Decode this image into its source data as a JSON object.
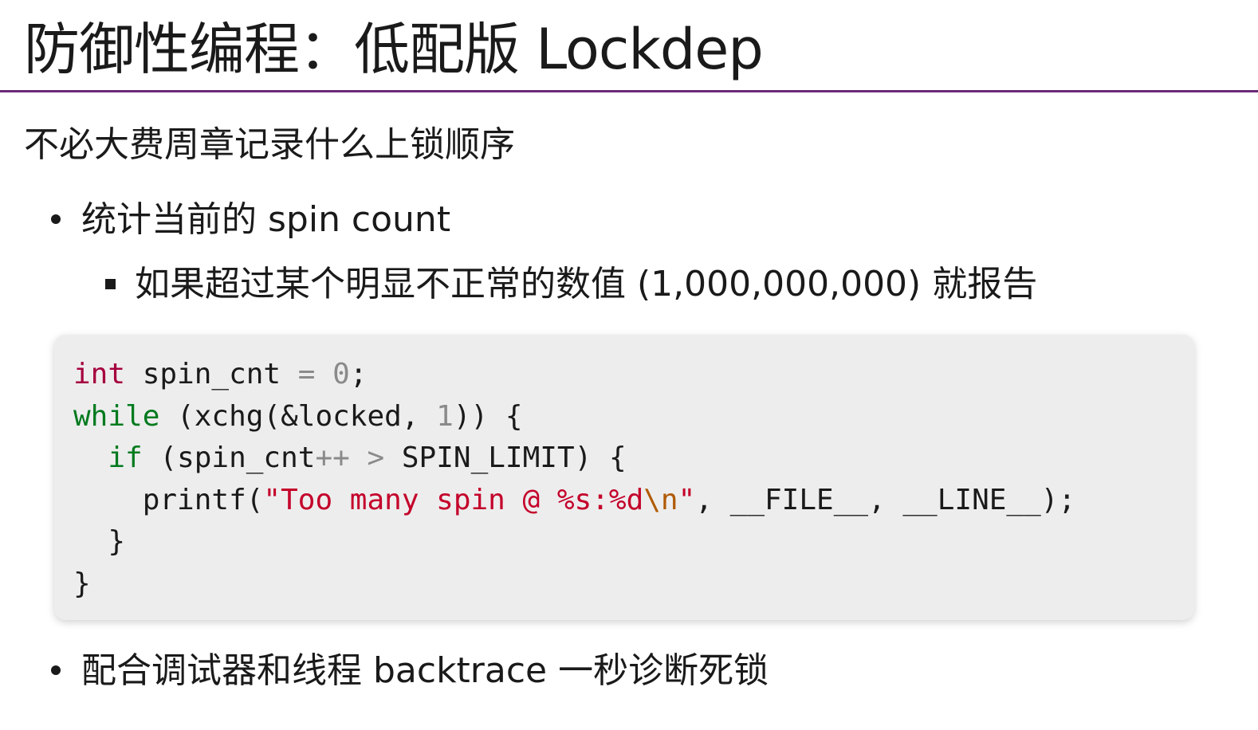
{
  "slide": {
    "title": "防御性编程：低配版 Lockdep",
    "intro": "不必大费周章记录什么上锁顺序",
    "bullets": [
      "统计当前的 spin count",
      "配合调试器和线程 backtrace 一秒诊断死锁"
    ],
    "sub_bullet": "如果超过某个明显不正常的数值 (1,000,000,000) 就报告",
    "code": {
      "line1": {
        "kw": "int",
        "ident": " spin_cnt ",
        "op": "=",
        "sp": " ",
        "num": "0",
        "end": ";"
      },
      "line2": {
        "kw": "while",
        "a": " (xchg(&locked, ",
        "num": "1",
        "b": ")) {"
      },
      "line3": {
        "indent": "  ",
        "kw": "if",
        "a": " (spin_cnt",
        "op1": "++",
        "sp": " ",
        "op2": ">",
        "b": " SPIN_LIMIT) {"
      },
      "line4": {
        "indent": "    printf(",
        "str": "\"Too many spin @ %s:%d",
        "esc": "\\n",
        "strend": "\"",
        "b": ", __FILE__, __LINE__);"
      },
      "line5": "  }",
      "line6": "}"
    }
  },
  "colors": {
    "accent_rule": "#6b2a78",
    "keyword_type": "#a5003e",
    "keyword_control": "#007a1e",
    "string": "#c4002a",
    "escape": "#b05a00",
    "code_background": "#ededed"
  }
}
